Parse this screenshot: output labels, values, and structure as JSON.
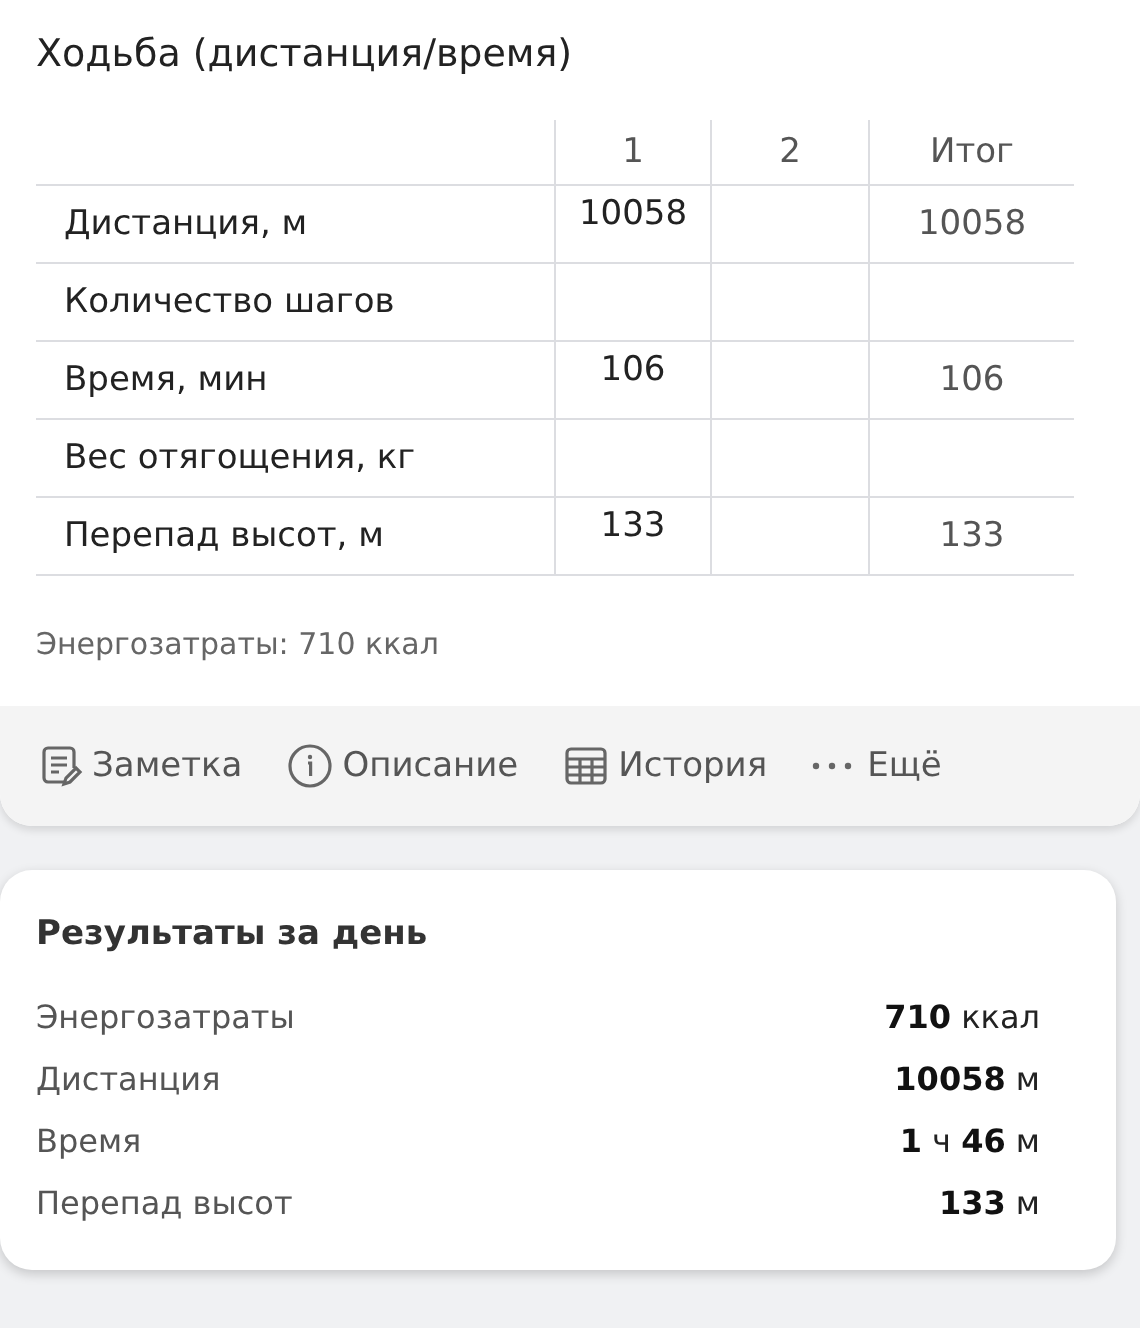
{
  "title": "Ходьба (дистанция/время)",
  "table": {
    "columns": [
      "1",
      "2",
      "Итог"
    ],
    "rows": [
      {
        "label": "Дистанция, м",
        "col_1": "10058",
        "total": "10058"
      },
      {
        "label": "Количество шагов"
      },
      {
        "label": "Время, мин",
        "col_1": "106",
        "total": "106"
      },
      {
        "label": "Вес отягощения, кг"
      },
      {
        "label": "Перепад высот, м",
        "col_1": "133",
        "total": "133"
      }
    ]
  },
  "energy": "Энергозатраты: 710 ккал",
  "toolbar": [
    {
      "kind": "note",
      "label": "Заметка"
    },
    {
      "kind": "info",
      "label": "Описание"
    },
    {
      "kind": "table",
      "label": "История"
    },
    {
      "kind": "more",
      "label": "Ещё"
    }
  ],
  "day_results": {
    "title": "Результаты за день",
    "rows": [
      {
        "label": "Энергозатраты",
        "value": "**710** ккал"
      },
      {
        "label": "Дистанция",
        "value": "**10058** м"
      },
      {
        "label": "Время",
        "value": "**1** ч **46** м"
      },
      {
        "label": "Перепад высот",
        "value": "**133** м"
      }
    ]
  }
}
